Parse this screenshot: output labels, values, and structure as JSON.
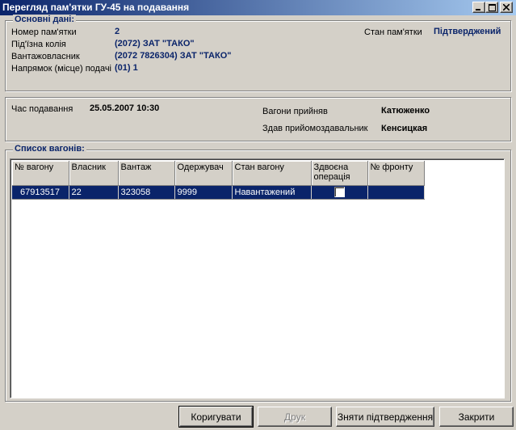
{
  "window": {
    "title": "Перегляд пам'ятки ГУ-45 на подавання"
  },
  "main_data": {
    "legend": "Основні дані:",
    "memo_number_label": "Номер пам'ятки",
    "memo_number_value": "2",
    "siding_label": "Під'їзна колія",
    "siding_value": "(2072) ЗАТ \"ТАКО\"",
    "cargo_owner_label": "Вантажовласник",
    "cargo_owner_value": "(2072 7826304) ЗАТ \"ТАКО\"",
    "direction_label": "Напрямок (місце) подачі",
    "direction_value": "(01) 1",
    "memo_state_label": "Стан пам'ятки",
    "memo_state_value": "Підтверджений"
  },
  "delivery": {
    "time_label": "Час подавання",
    "time_value": "25.05.2007 10:30",
    "accepted_label": "Вагони прийняв",
    "accepted_value": "Катюженко",
    "handed_label": "Здав прийомоздавальник",
    "handed_value": "Кенсицкая"
  },
  "wagons": {
    "legend": "Список вагонів:",
    "columns": [
      "№ вагону",
      "Власник",
      "Вантаж",
      "Одержувач",
      "Стан вагону",
      "Здвоєна операція",
      "№ фронту"
    ],
    "rows": [
      {
        "wagon": "67913517",
        "owner": "22",
        "cargo": "323058",
        "receiver": "9999",
        "state": "Навантажений",
        "double_op": false,
        "front": ""
      }
    ]
  },
  "buttons": {
    "edit": "Коригувати",
    "print": "Друк",
    "unconfirm": "Зняти підтвердження",
    "close": "Закрити"
  },
  "colors": {
    "title_start": "#0a246a",
    "title_end": "#a6caf0",
    "selection": "#0a246a",
    "value_text": "#0a246a"
  }
}
